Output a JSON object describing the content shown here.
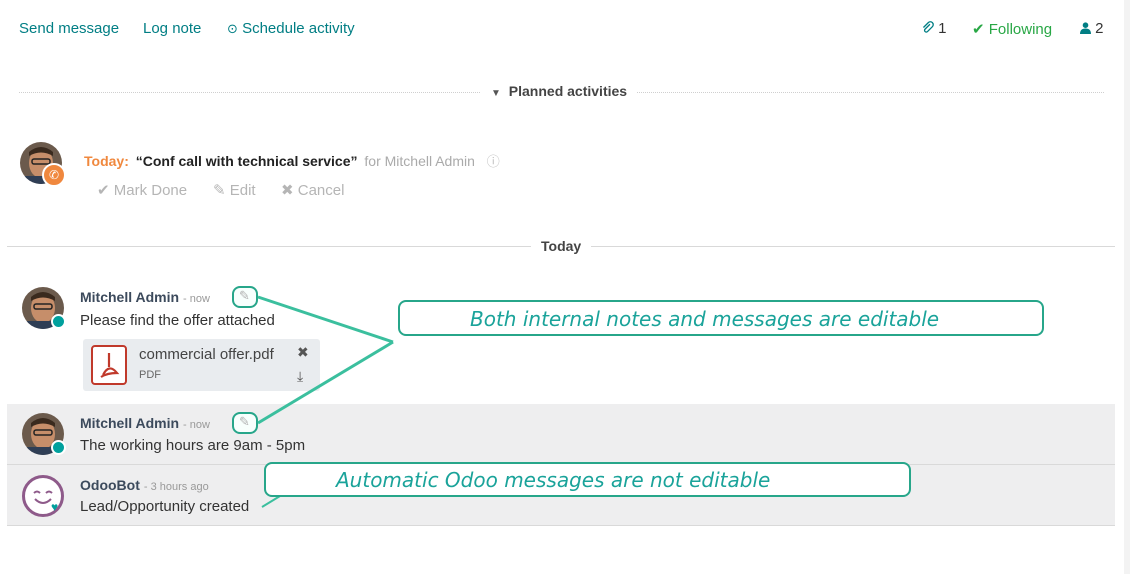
{
  "topbar": {
    "send_message": "Send message",
    "log_note": "Log note",
    "schedule_activity": "Schedule activity",
    "attachments_count": "1",
    "following_label": "Following",
    "followers_count": "2"
  },
  "planned": {
    "header": "Planned activities",
    "activity": {
      "due_label": "Today:",
      "title": "“Conf call with technical service”",
      "for_text": "for Mitchell Admin",
      "mark_done": "Mark Done",
      "edit": "Edit",
      "cancel": "Cancel"
    }
  },
  "thread": {
    "date_header": "Today",
    "messages": [
      {
        "author": "Mitchell Admin",
        "time": "- now",
        "body": "Please find the offer attached"
      },
      {
        "author": "Mitchell Admin",
        "time": "- now",
        "body": "The working hours are 9am - 5pm"
      },
      {
        "author": "OdooBot",
        "time": "- 3 hours ago",
        "body": "Lead/Opportunity created"
      }
    ],
    "attachment": {
      "filename": "commercial offer.pdf",
      "type": "PDF"
    }
  },
  "callouts": {
    "editable": "Both internal notes and messages are editable",
    "not_editable": "Automatic Odoo messages are not editable"
  },
  "colors": {
    "accent": "#017e84",
    "following": "#28a745",
    "today_label": "#f0883e",
    "callout": "#27a68a",
    "status": "#00a09d"
  }
}
